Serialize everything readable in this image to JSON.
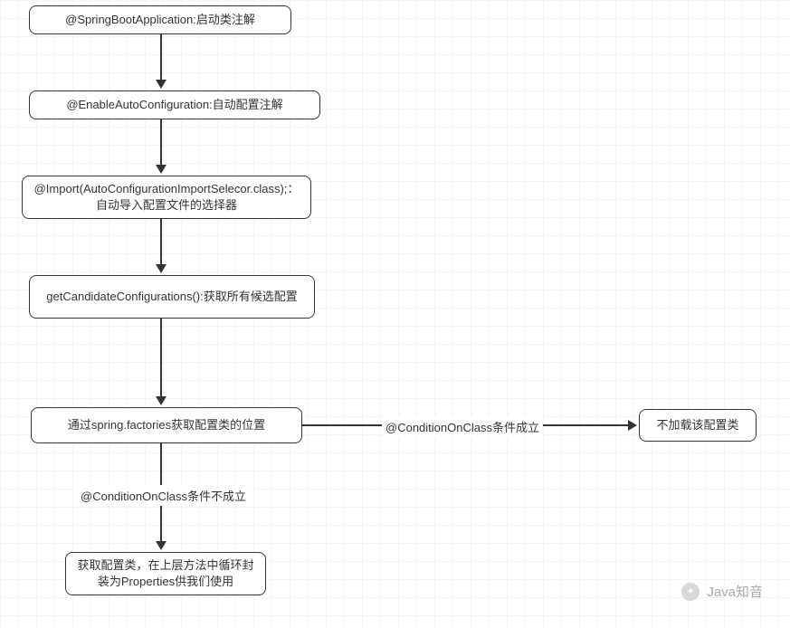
{
  "nodes": {
    "n1": "@SpringBootApplication:启动类注解",
    "n2": "@EnableAutoConfiguration:自动配置注解",
    "n3": "@Import(AutoConfigurationImportSelecor.class);：自动导入配置文件的选择器",
    "n4": "getCandidateConfigurations():获取所有候选配置",
    "n5": "通过spring.factories获取配置类的位置",
    "n6": "获取配置类，在上层方法中循环封装为Properties供我们使用",
    "n7": "不加载该配置类"
  },
  "edgeLabels": {
    "e_false": "@ConditionOnClass条件不成立",
    "e_true": "@ConditionOnClass条件成立"
  },
  "watermark": "Java知音"
}
